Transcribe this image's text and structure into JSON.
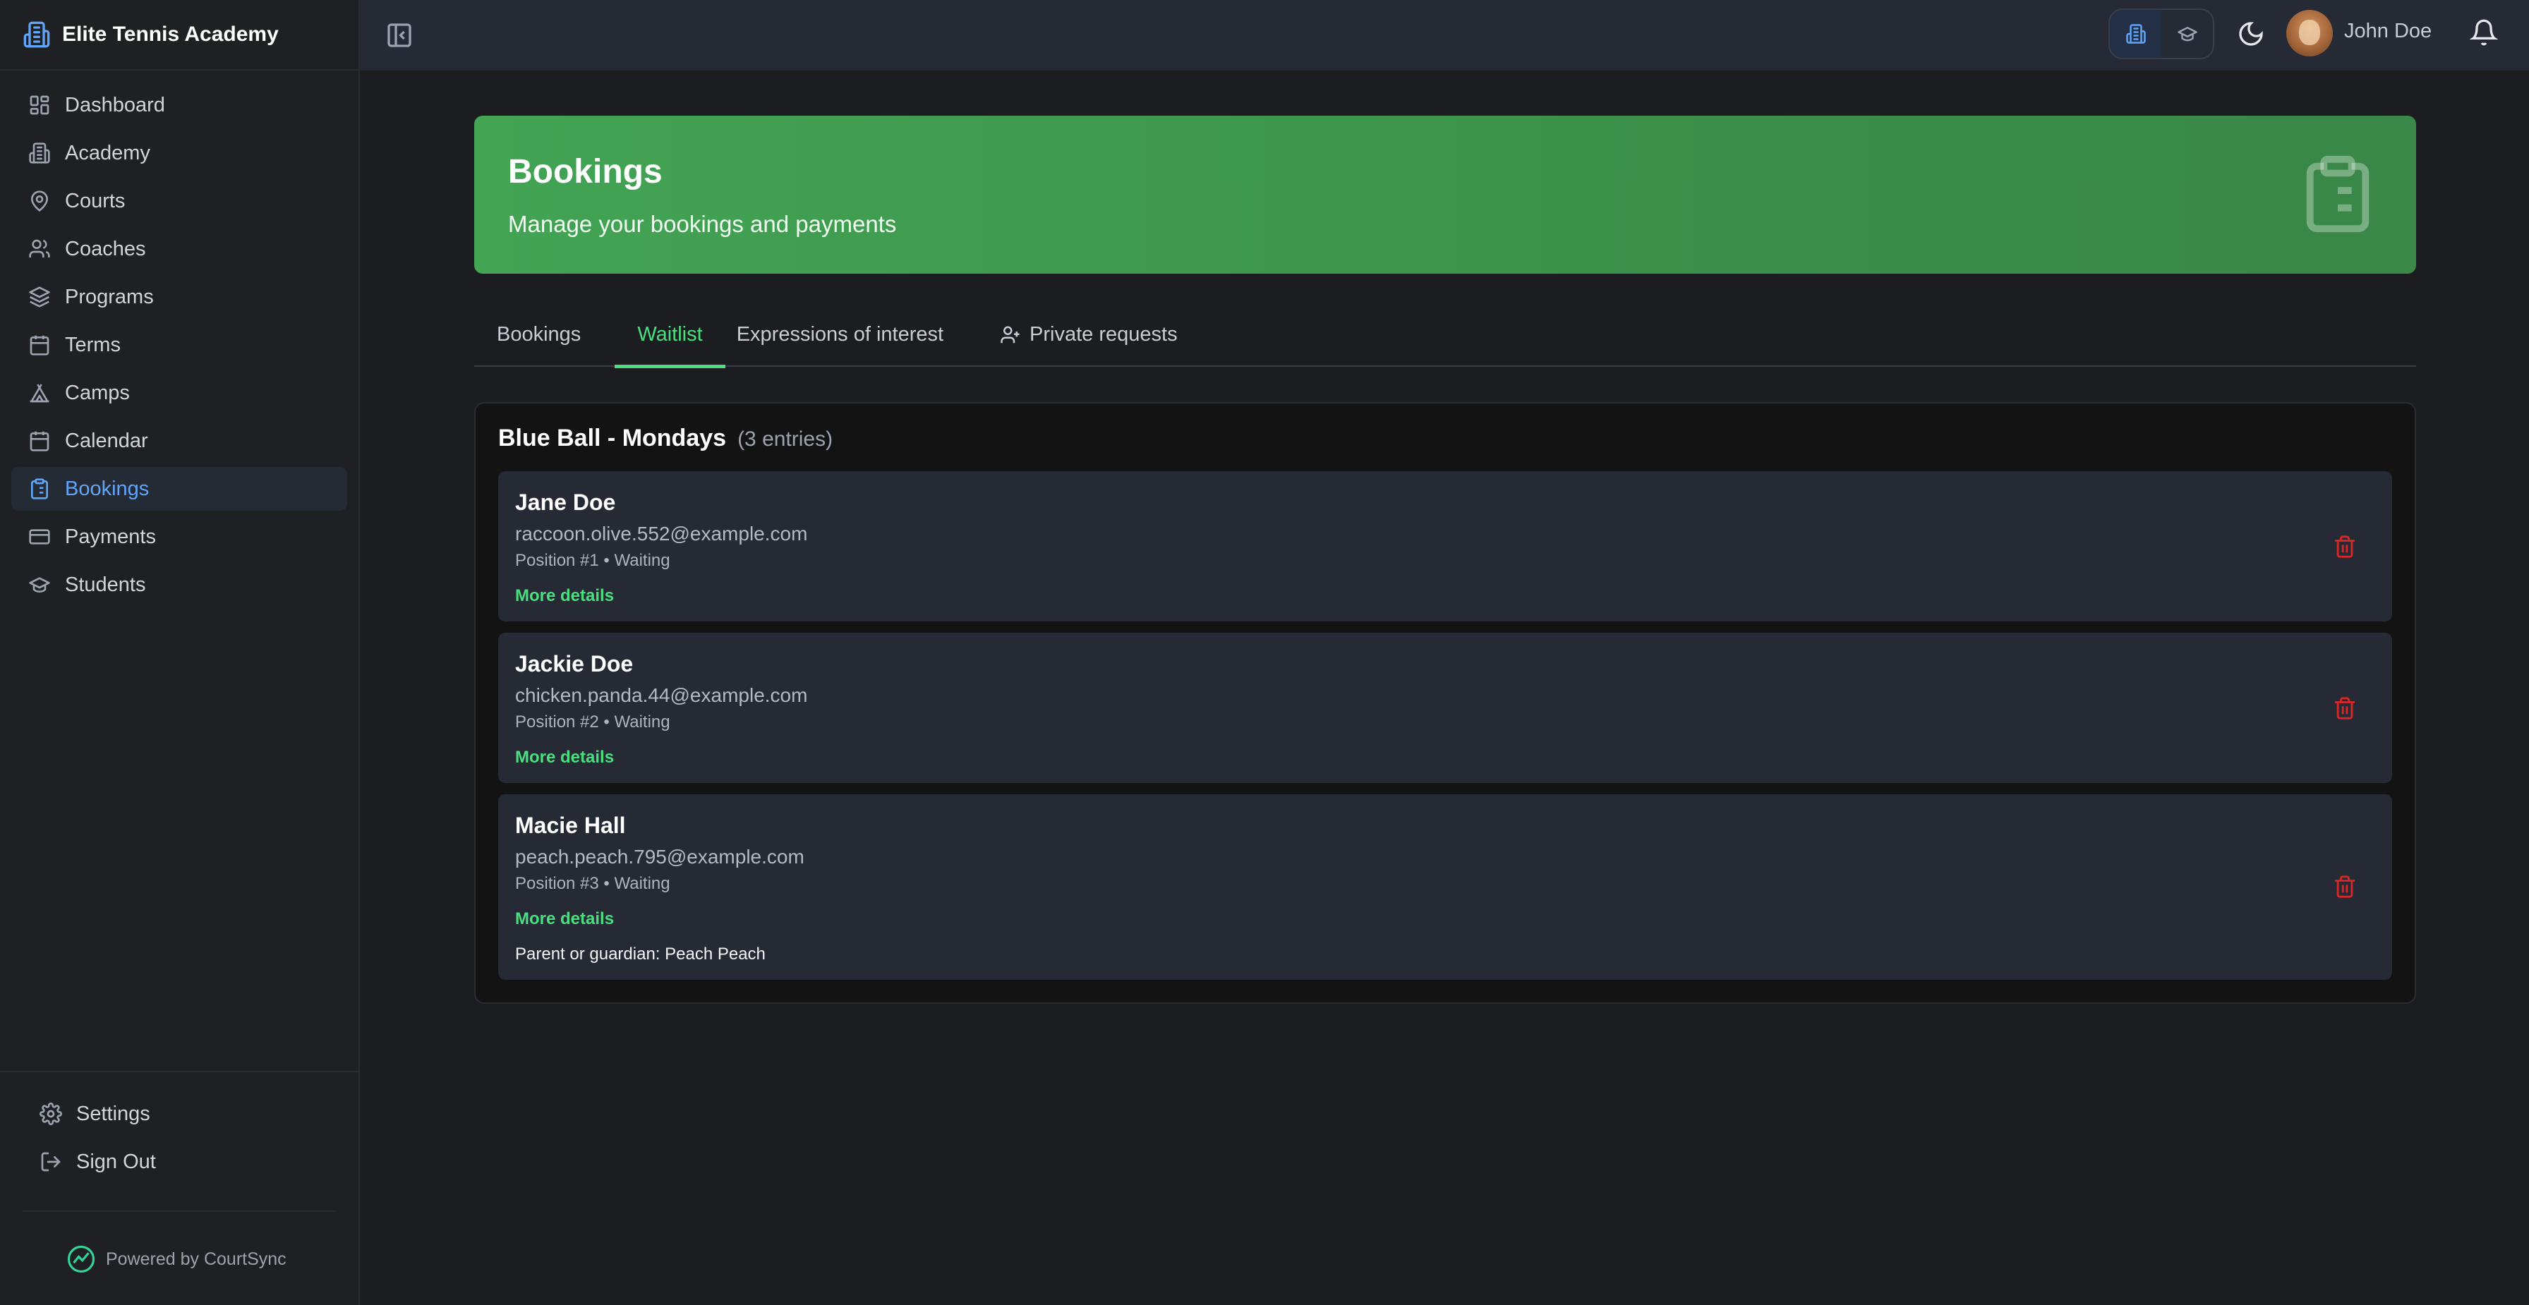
{
  "brand": {
    "name": "Elite Tennis Academy",
    "icon": "building-icon"
  },
  "sidebar": {
    "items": [
      {
        "label": "Dashboard",
        "icon": "dashboard-icon",
        "active": false
      },
      {
        "label": "Academy",
        "icon": "building-icon",
        "active": false
      },
      {
        "label": "Courts",
        "icon": "map-pin-icon",
        "active": false
      },
      {
        "label": "Coaches",
        "icon": "users-icon",
        "active": false
      },
      {
        "label": "Programs",
        "icon": "layers-icon",
        "active": false
      },
      {
        "label": "Terms",
        "icon": "calendar-icon",
        "active": false
      },
      {
        "label": "Camps",
        "icon": "tent-icon",
        "active": false
      },
      {
        "label": "Calendar",
        "icon": "calendar-days-icon",
        "active": false
      },
      {
        "label": "Bookings",
        "icon": "clipboard-icon",
        "active": true
      },
      {
        "label": "Payments",
        "icon": "credit-card-icon",
        "active": false
      },
      {
        "label": "Students",
        "icon": "graduation-cap-icon",
        "active": false
      }
    ],
    "bottom": [
      {
        "label": "Settings",
        "icon": "gear-icon"
      },
      {
        "label": "Sign Out",
        "icon": "sign-out-icon"
      }
    ],
    "powered_by": "Powered by CourtSync"
  },
  "topbar": {
    "user_name": "John Doe",
    "role_switch": {
      "active": "academy"
    }
  },
  "hero": {
    "title": "Bookings",
    "subtitle": "Manage your bookings and payments",
    "color": "#43a454"
  },
  "tabs": [
    {
      "label": "Bookings",
      "active": false
    },
    {
      "label": "Waitlist",
      "active": true
    },
    {
      "label": "Expressions of interest",
      "active": false
    },
    {
      "label": "Private requests",
      "active": false,
      "icon": "user-plus-icon"
    }
  ],
  "waitlist": {
    "group_title": "Blue Ball - Mondays",
    "group_count": "(3 entries)",
    "entries": [
      {
        "name": "Jane Doe",
        "email": "raccoon.olive.552@example.com",
        "status": "Position #1 • Waiting",
        "more": "More details"
      },
      {
        "name": "Jackie Doe",
        "email": "chicken.panda.44@example.com",
        "status": "Position #2 • Waiting",
        "more": "More details"
      },
      {
        "name": "Macie Hall",
        "email": "peach.peach.795@example.com",
        "status": "Position #3 • Waiting",
        "more": "More details",
        "guardian": "Parent or guardian: Peach Peach"
      }
    ]
  },
  "colors": {
    "accent": "#60a5fa",
    "success": "#4ade80",
    "danger": "#dc2626"
  }
}
